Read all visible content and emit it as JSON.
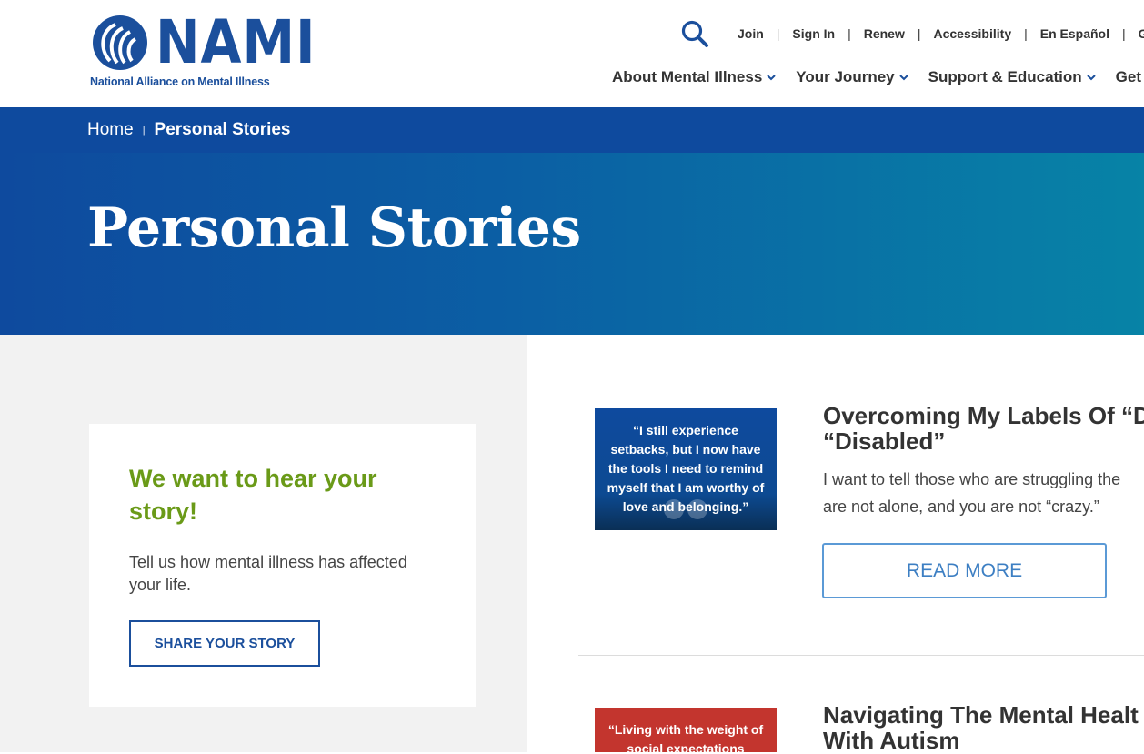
{
  "header": {
    "logo": {
      "wordmark": "NAMI",
      "tagline": "National Alliance on Mental Illness"
    },
    "utility_links": [
      "Join",
      "Sign In",
      "Renew",
      "Accessibility",
      "En Español",
      "Ge"
    ],
    "nav": [
      "About Mental Illness",
      "Your Journey",
      "Support & Education",
      "Get Inv"
    ]
  },
  "breadcrumb": {
    "home": "Home",
    "current": "Personal Stories"
  },
  "hero": {
    "title": "Personal Stories"
  },
  "sidebar": {
    "heading": "We want to hear your story!",
    "text": "Tell us how mental illness has affected your life.",
    "button": "SHARE YOUR STORY"
  },
  "stories": [
    {
      "thumb_quote": "“I still experience setbacks, but I now have the tools I need to remind myself that I am worthy of love and belonging.”",
      "title_line1": "Overcoming My Labels Of “D",
      "title_line2": "“Disabled”",
      "excerpt_line1": "I want to tell those who are struggling the",
      "excerpt_line2": "are not alone, and you are not “crazy.”",
      "button": "READ MORE"
    },
    {
      "thumb_quote": "“Living with the weight of social expectations",
      "title_line1": "Navigating The Mental Healt",
      "title_line2": "With Autism"
    }
  ],
  "colors": {
    "brand_blue": "#1b4f9c",
    "crumb_bar": "#0e4a9e",
    "accent_green": "#6a9a18",
    "thumb_red": "#c3352e"
  }
}
